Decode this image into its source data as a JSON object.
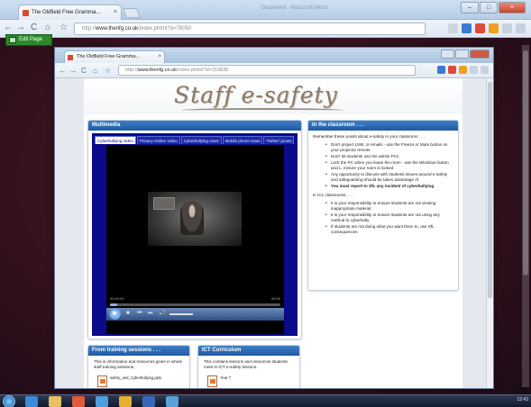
{
  "outer_browser": {
    "tab_title": "The Oldfield Free Gramma...",
    "close_label": "×",
    "ghost_title": "Document - Microsoft Word",
    "window_controls": [
      "–",
      "□",
      "×"
    ],
    "url_prefix": "http://",
    "url_domain": "www.thenfg.co.uk",
    "url_path": "/index.phtml?d=78050",
    "nav": [
      "←",
      "→",
      "C",
      "⌂",
      "☆"
    ]
  },
  "edit_page_label": "Edit Page",
  "inner_browser": {
    "tab_title": "The Oldfield Free Gramma...",
    "close_label": "×",
    "url_prefix": "http://",
    "url_domain": "www.thenfg.co.uk",
    "url_path": "/index.phtml?d=153838",
    "nav": [
      "←",
      "→",
      "C",
      "⌂",
      "☆"
    ]
  },
  "site": {
    "banner_title": "Staff e-safety"
  },
  "multimedia": {
    "heading": "Multimedia",
    "tabs": [
      "Cyberbullying Video",
      "Privacy Online Video",
      "Cyberbullying news",
      "Mobile phone news",
      "Twitter/ grown"
    ],
    "time_left": "00:00:00",
    "time_right": "00:00",
    "progress": 0.04,
    "play_icon": "▶",
    "ctrl_icons": [
      "■",
      "⏮",
      "⏭",
      "🔊"
    ]
  },
  "classroom": {
    "heading": "In the classroom . . .",
    "intro": "Remember these points about e-safety in your classroom . . .",
    "points": [
      "Don't project USB, or emails - use the Freeze or Mute button on your projector remote",
      "Don't let students use the admin PCs",
      "Lock the PC when you leave the room - use the Windows button and L, ensure your room is locked",
      "Any opportunity to discuss with students issues around e-safety and safeguarding should be taken advantage of",
      "You must report to SfL any incident of cyberbullying"
    ],
    "ict_intro": "In ICL classrooms . . .",
    "ict_points": [
      "It is your responsibility to ensure students are not viewing inappropriate material",
      "It is your responsibility to ensure students are not using any method to cyberbully",
      "If students are not doing what you want them to, use SfL consequences"
    ]
  },
  "training": {
    "heading": "From training sessions . . .",
    "body": "This is information and resources given in whole staff training sessions.",
    "doc_label": "safety_and_Cyberbullying.pptx"
  },
  "ict_curriculum": {
    "heading": "ICT Curriculum",
    "body": "This contains lessons and resources students meet in ICT e-safety lessons.",
    "doc_label": "Year 7"
  },
  "taskbar": {
    "tray_text": "12:43"
  },
  "colors": {
    "panel_header": "#2a66b0",
    "media_background": "#0a0a8a",
    "banner_text": "#8a7a68",
    "stage_background": "#3a1220"
  }
}
